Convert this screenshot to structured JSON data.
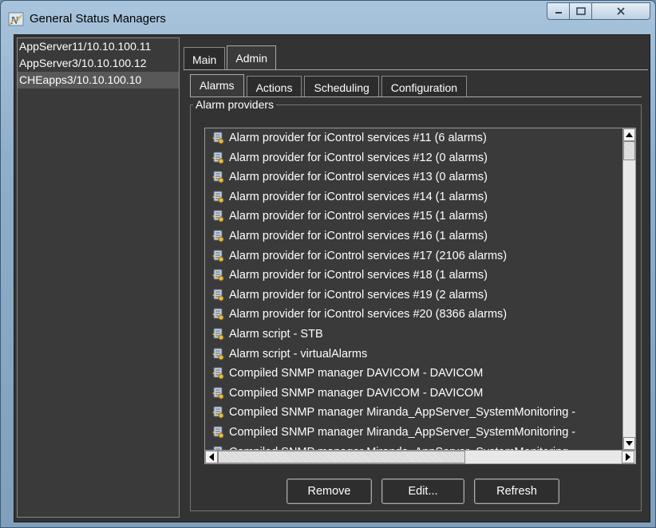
{
  "window": {
    "title": "General Status Managers",
    "icon": "iControl-N-app-icon"
  },
  "servers": [
    "AppServer11/10.10.100.11",
    "AppServer3/10.10.100.12",
    "CHEapps3/10.10.100.10"
  ],
  "selected_server_index": 2,
  "main_tabs": [
    "Main",
    "Admin"
  ],
  "main_tab_active": "Admin",
  "sub_tabs": [
    "Alarms",
    "Actions",
    "Scheduling",
    "Configuration"
  ],
  "sub_tab_active": "Alarms",
  "group_title": "Alarm providers",
  "providers": [
    "Alarm provider for iControl services #11 (6 alarms)",
    "Alarm provider for iControl services #12 (0 alarms)",
    "Alarm provider for iControl services #13 (0 alarms)",
    "Alarm provider for iControl services #14 (1 alarms)",
    "Alarm provider for iControl services #15 (1 alarms)",
    "Alarm provider for iControl services #16 (1 alarms)",
    "Alarm provider for iControl services #17 (2106 alarms)",
    "Alarm provider for iControl services #18 (1 alarms)",
    "Alarm provider for iControl services #19 (2 alarms)",
    "Alarm provider for iControl services #20 (8366 alarms)",
    "Alarm script - STB",
    "Alarm script - virtualAlarms",
    "Compiled SNMP manager DAVICOM - DAVICOM",
    "Compiled SNMP manager DAVICOM - DAVICOM",
    "Compiled SNMP manager Miranda_AppServer_SystemMonitoring - ",
    "Compiled SNMP manager Miranda_AppServer_SystemMonitoring - ",
    "Compiled SNMP manager Miranda_AppServer_SystemMonitoring - "
  ],
  "buttons": {
    "remove": "Remove",
    "edit": "Edit...",
    "refresh": "Refresh"
  },
  "colors": {
    "background": "#333333",
    "text": "#ffffff",
    "list_background": "#3a3a3a",
    "selected": "#585858",
    "frame": "#8eaecb"
  }
}
